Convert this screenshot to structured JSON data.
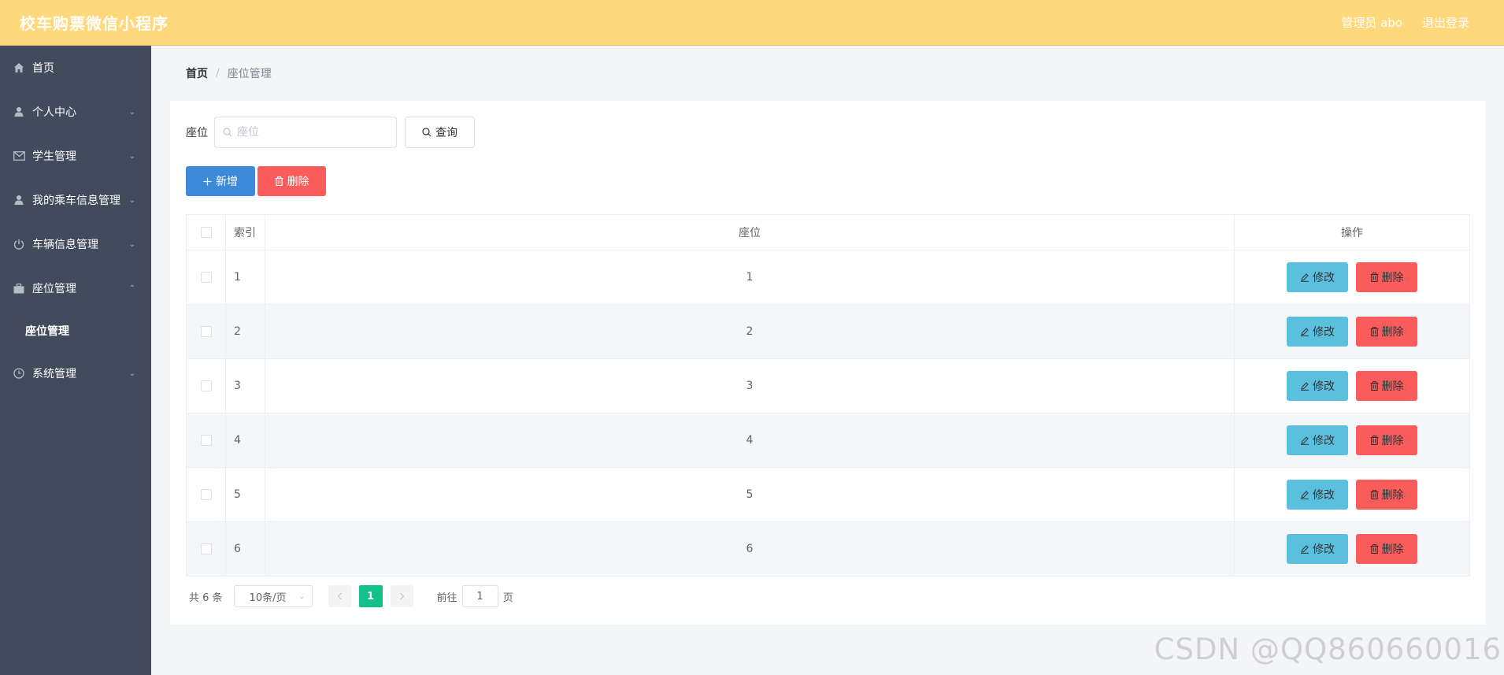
{
  "app": {
    "title": "校车购票微信小程序"
  },
  "header": {
    "user_label": "管理员 abo",
    "logout_label": "退出登录"
  },
  "sidebar": {
    "items": [
      {
        "label": "首页",
        "icon": "home-icon"
      },
      {
        "label": "个人中心",
        "icon": "user-icon"
      },
      {
        "label": "学生管理",
        "icon": "mail-icon"
      },
      {
        "label": "我的乘车信息管理",
        "icon": "user-icon"
      },
      {
        "label": "车辆信息管理",
        "icon": "power-icon"
      },
      {
        "label": "座位管理",
        "icon": "briefcase-icon",
        "expanded": true,
        "children": [
          {
            "label": "座位管理"
          }
        ]
      },
      {
        "label": "系统管理",
        "icon": "clock-icon"
      }
    ]
  },
  "breadcrumb": {
    "home": "首页",
    "separator": "/",
    "current": "座位管理"
  },
  "search": {
    "label": "座位",
    "placeholder": "座位",
    "value": "",
    "button_label": "查询"
  },
  "actions": {
    "add_label": "新增",
    "delete_label": "删除"
  },
  "table": {
    "columns": {
      "index": "索引",
      "seat": "座位",
      "ops": "操作"
    },
    "rows": [
      {
        "index": "1",
        "seat": "1"
      },
      {
        "index": "2",
        "seat": "2"
      },
      {
        "index": "3",
        "seat": "3"
      },
      {
        "index": "4",
        "seat": "4"
      },
      {
        "index": "5",
        "seat": "5"
      },
      {
        "index": "6",
        "seat": "6"
      }
    ],
    "edit_label": "修改",
    "delete_label": "删除"
  },
  "pagination": {
    "total_text": "共 6 条",
    "page_size": "10条/页",
    "current_page": "1",
    "goto_label": "前往",
    "goto_value": "1",
    "page_suffix": "页"
  },
  "watermark": "CSDN @QQ860660016",
  "colors": {
    "header": "#ffd87b",
    "sidebar": "#424b5c",
    "primary": "#3d8ad8",
    "danger": "#fa5b5b",
    "info": "#5bc0de",
    "page_active": "#13c08a"
  }
}
